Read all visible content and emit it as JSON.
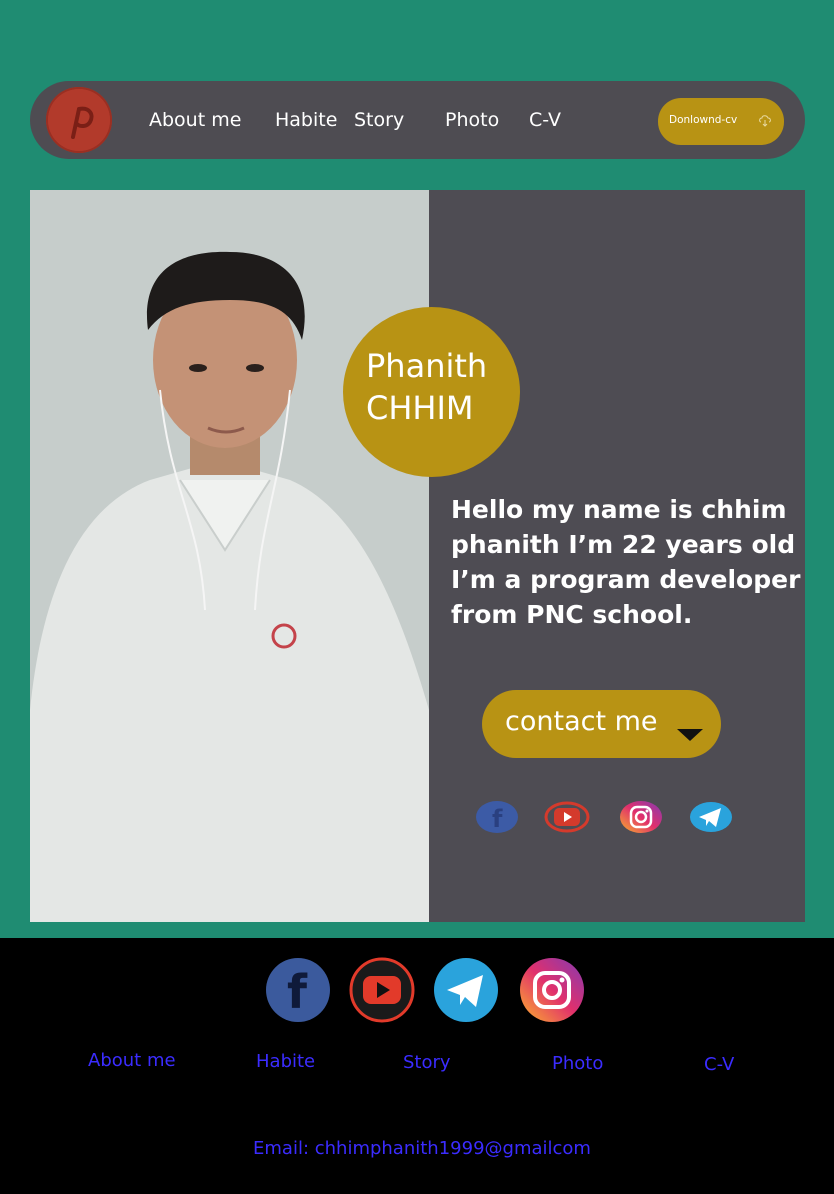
{
  "navbar": {
    "logo_icon": "pinterest-icon",
    "links": [
      "About me",
      "Habite",
      "Story",
      "Photo",
      "C-V"
    ],
    "cv_button": {
      "label": "Donlownd-cv",
      "icon": "download-icon"
    }
  },
  "hero": {
    "photo_alt": "portrait-photo",
    "name_first": "Phanith",
    "name_last": "CHHIM",
    "intro": "Hello my name is chhim phanith I’m 22 years old I’m a program developer from PNC school.",
    "contact_button": {
      "label": "contact me",
      "icon": "caret-down-icon"
    },
    "socials": [
      "facebook-icon",
      "youtube-icon",
      "instagram-icon",
      "telegram-icon"
    ]
  },
  "footer": {
    "socials": [
      "facebook-icon",
      "youtube-icon",
      "telegram-icon",
      "instagram-icon"
    ],
    "links": [
      "About me",
      "Habite",
      "Story",
      "Photo",
      "C-V"
    ],
    "email": "Email: chhimphanith1999@gmailcom"
  },
  "colors": {
    "background": "#1f8c72",
    "panel": "#4e4c53",
    "accent": "#b89314",
    "footer": "#000000",
    "footer_link": "#3b2cff"
  }
}
